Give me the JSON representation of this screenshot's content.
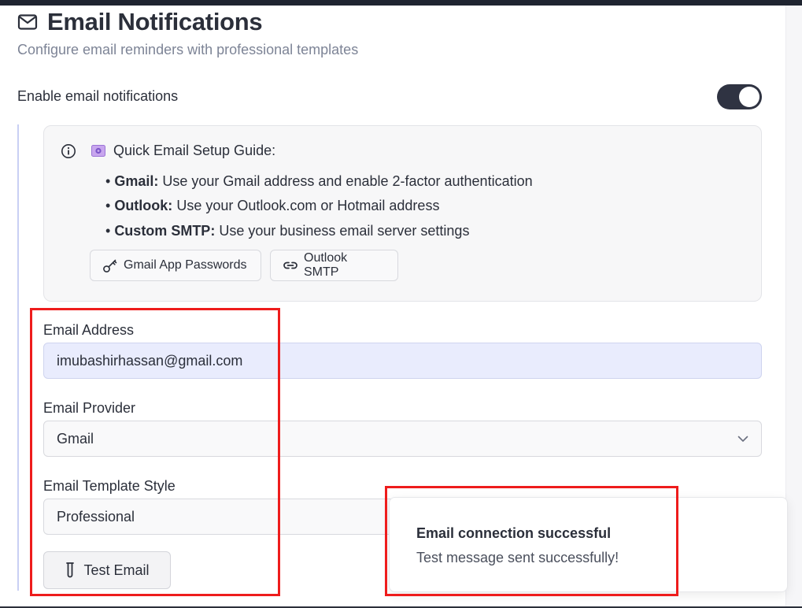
{
  "header": {
    "title": "Email Notifications",
    "subtitle": "Configure email reminders with professional templates"
  },
  "enable": {
    "label": "Enable email notifications",
    "enabled": true
  },
  "guide": {
    "title": "Quick Email Setup Guide:",
    "items": [
      {
        "bold": "Gmail:",
        "text": " Use your Gmail address and enable 2-factor authentication"
      },
      {
        "bold": "Outlook:",
        "text": " Use your Outlook.com or Hotmail address"
      },
      {
        "bold": "Custom SMTP:",
        "text": " Use your business email server settings"
      }
    ],
    "buttons": {
      "gmail": "Gmail App Passwords",
      "outlook": "Outlook SMTP"
    }
  },
  "form": {
    "email_label": "Email Address",
    "email_value": "imubashirhassan@gmail.com",
    "provider_label": "Email Provider",
    "provider_value": "Gmail",
    "template_label": "Email Template Style",
    "template_value": "Professional",
    "test_button": "Test Email"
  },
  "toast": {
    "title": "Email connection successful",
    "message": "Test message sent successfully!"
  },
  "colors": {
    "accent_toggle": "#2f3342",
    "highlight": "#ee1c1c",
    "email_field_bg": "#e9ecfd"
  },
  "icons": [
    "mail-icon",
    "info-icon",
    "envelope-emoji-icon",
    "key-icon",
    "link-icon",
    "chevron-down-icon",
    "test-tube-icon"
  ]
}
